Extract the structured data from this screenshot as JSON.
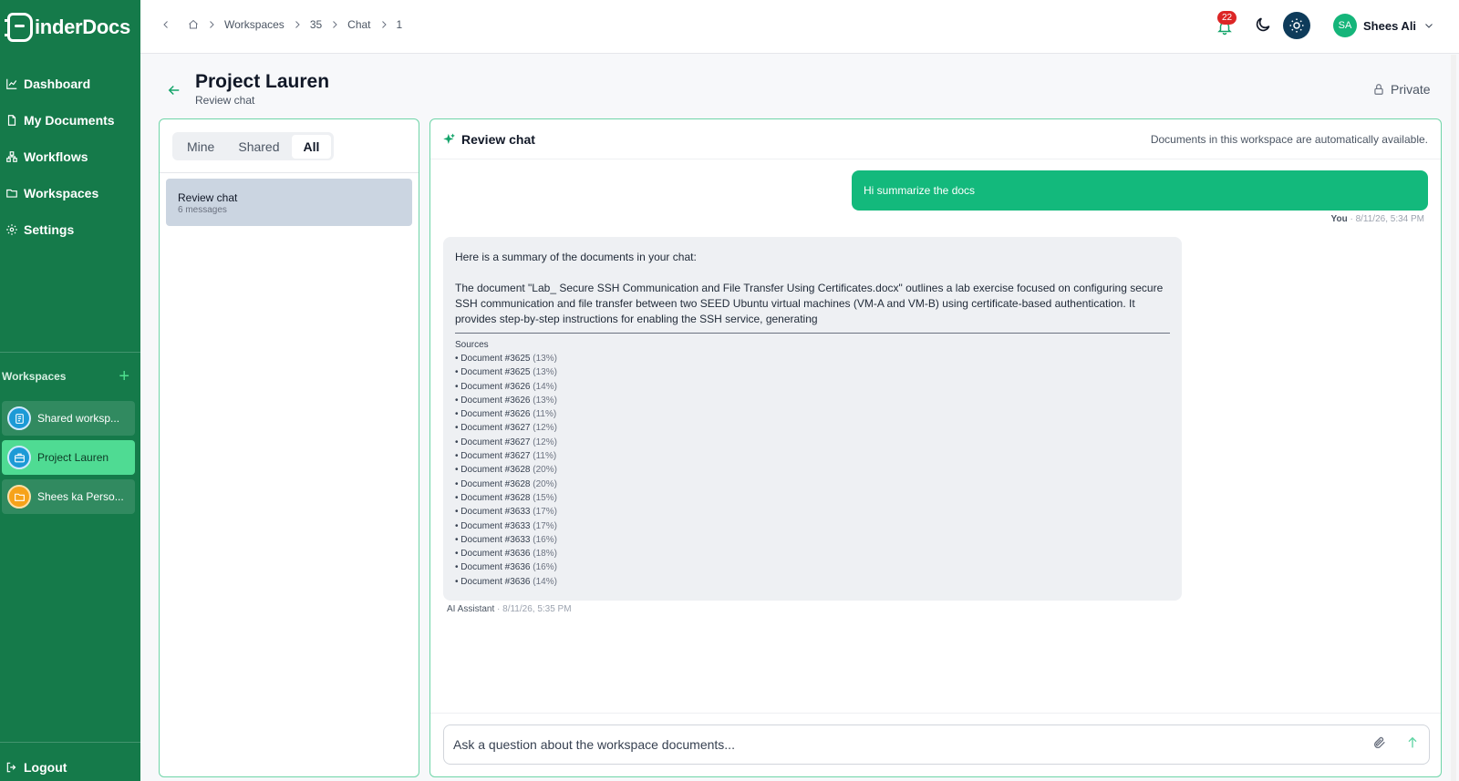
{
  "sidebar": {
    "logo": "inderDocs",
    "nav": [
      {
        "label": "Dashboard",
        "icon": "chart-icon"
      },
      {
        "label": "My Documents",
        "icon": "document-icon"
      },
      {
        "label": "Workflows",
        "icon": "workflow-icon"
      },
      {
        "label": "Workspaces",
        "icon": "folder-icon"
      },
      {
        "label": "Settings",
        "icon": "gear-icon"
      }
    ],
    "workspaces_label": "Workspaces",
    "add_symbol": "+",
    "workspaces": [
      {
        "name": "Shared worksp...",
        "icon": "document-list-icon",
        "color": "#1c9ad6",
        "active": false
      },
      {
        "name": "Project Lauren",
        "icon": "briefcase-icon",
        "color": "#1c9ad6",
        "active": true
      },
      {
        "name": "Shees ka Perso...",
        "icon": "folder-icon",
        "color": "#f6a21a",
        "active": false
      }
    ],
    "logout": "Logout"
  },
  "topbar": {
    "breadcrumbs": [
      "Workspaces",
      "35",
      "Chat",
      "1"
    ],
    "notifications": "22",
    "user_initials": "SA",
    "user_name": "Shees Ali"
  },
  "page": {
    "title": "Project Lauren",
    "subtitle": "Review chat",
    "visibility": "Private"
  },
  "filters": {
    "tabs": [
      "Mine",
      "Shared",
      "All"
    ],
    "active": "All"
  },
  "chat_list": [
    {
      "title": "Review chat",
      "count": "6 messages"
    }
  ],
  "chat": {
    "title": "Review chat",
    "note": "Documents in this workspace are automatically available.",
    "user_message": "Hi summarize the docs",
    "user_author": "You",
    "user_time": "· 8/11/26, 5:34 PM",
    "ai_intro": "Here is a summary of the documents in your chat:",
    "ai_body": "The document \"Lab_ Secure SSH Communication and File Transfer Using Certificates.docx\" outlines a lab exercise focused on configuring secure SSH communication and file transfer between two SEED Ubuntu virtual machines (VM-A and VM-B) using certificate-based authentication. It provides step-by-step instructions for enabling the SSH service, generating",
    "sources_label": "Sources",
    "sources": [
      {
        "doc": "• Document #3625",
        "pct": "(13%)"
      },
      {
        "doc": "• Document #3625",
        "pct": "(13%)"
      },
      {
        "doc": "• Document #3626",
        "pct": "(14%)"
      },
      {
        "doc": "• Document #3626",
        "pct": "(13%)"
      },
      {
        "doc": "• Document #3626",
        "pct": "(11%)"
      },
      {
        "doc": "• Document #3627",
        "pct": "(12%)"
      },
      {
        "doc": "• Document #3627",
        "pct": "(12%)"
      },
      {
        "doc": "• Document #3627",
        "pct": "(11%)"
      },
      {
        "doc": "• Document #3628",
        "pct": "(20%)"
      },
      {
        "doc": "• Document #3628",
        "pct": "(20%)"
      },
      {
        "doc": "• Document #3628",
        "pct": "(15%)"
      },
      {
        "doc": "• Document #3633",
        "pct": "(17%)"
      },
      {
        "doc": "• Document #3633",
        "pct": "(17%)"
      },
      {
        "doc": "• Document #3633",
        "pct": "(16%)"
      },
      {
        "doc": "• Document #3636",
        "pct": "(18%)"
      },
      {
        "doc": "• Document #3636",
        "pct": "(16%)"
      },
      {
        "doc": "• Document #3636",
        "pct": "(14%)"
      }
    ],
    "ai_author": "AI Assistant",
    "ai_time": "· 8/11/26, 5:35 PM",
    "composer_placeholder": "Ask a question about the workspace documents..."
  },
  "colors": {
    "sidebar": "#157a4a",
    "accent": "#13b97c",
    "active_workspace": "#4fdb93"
  }
}
